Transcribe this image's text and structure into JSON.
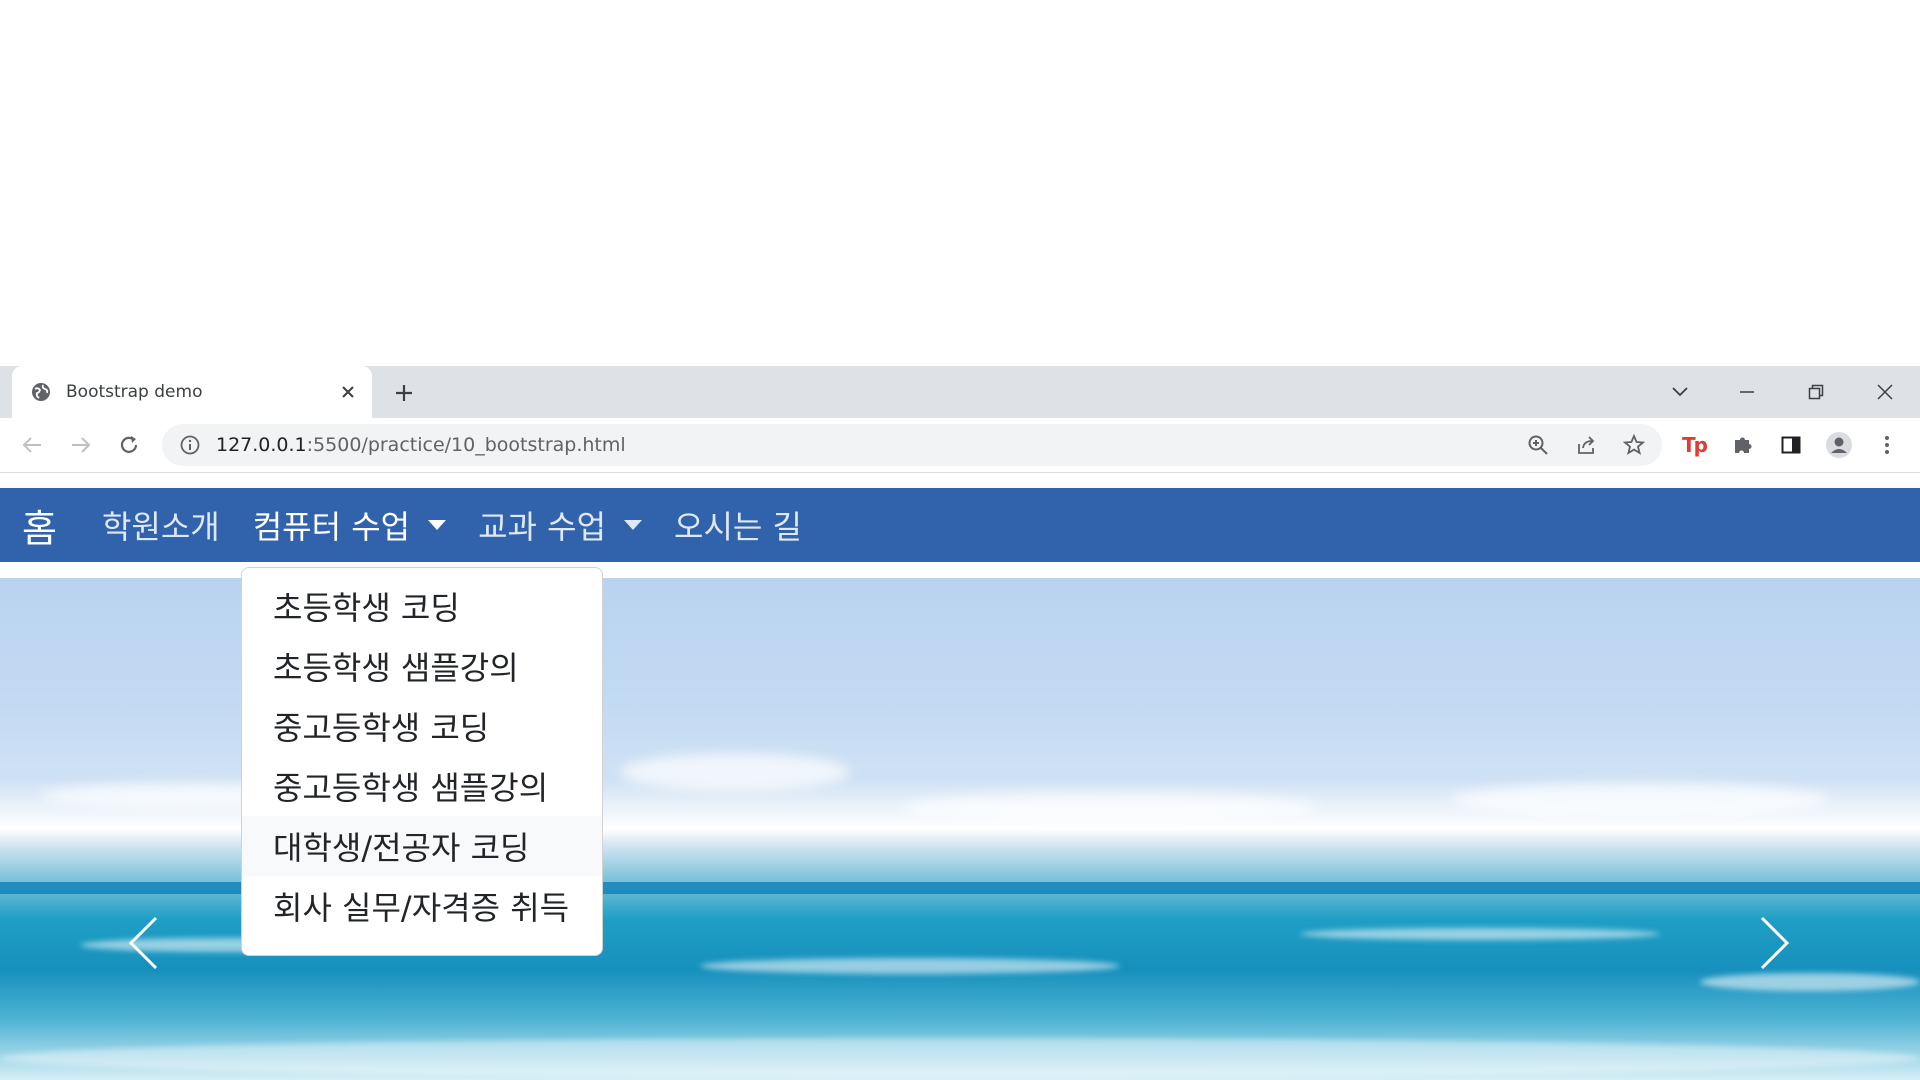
{
  "browser": {
    "tab": {
      "title": "Bootstrap demo",
      "favicon": "globe-icon"
    },
    "url_host": "127.0.0.1",
    "url_path": ":5500/practice/10_bootstrap.html",
    "extension_label": "Tp"
  },
  "navbar": {
    "brand": "홈",
    "items": [
      {
        "label": "학원소개",
        "has_dropdown": false
      },
      {
        "label": "컴퓨터 수업",
        "has_dropdown": true
      },
      {
        "label": "교과 수업",
        "has_dropdown": true
      },
      {
        "label": "오시는 길",
        "has_dropdown": false
      }
    ],
    "color": "#3163ad"
  },
  "dropdown": {
    "items": [
      "초등학생 코딩",
      "초등학생 샘플강의",
      "중고등학생 코딩",
      "중고등학생 샘플강의",
      "대학생/전공자 코딩",
      "회사 실무/자격증 취득"
    ],
    "hovered_index": 4
  },
  "carousel": {
    "prev_icon": "chevron-left-icon",
    "next_icon": "chevron-right-icon"
  }
}
